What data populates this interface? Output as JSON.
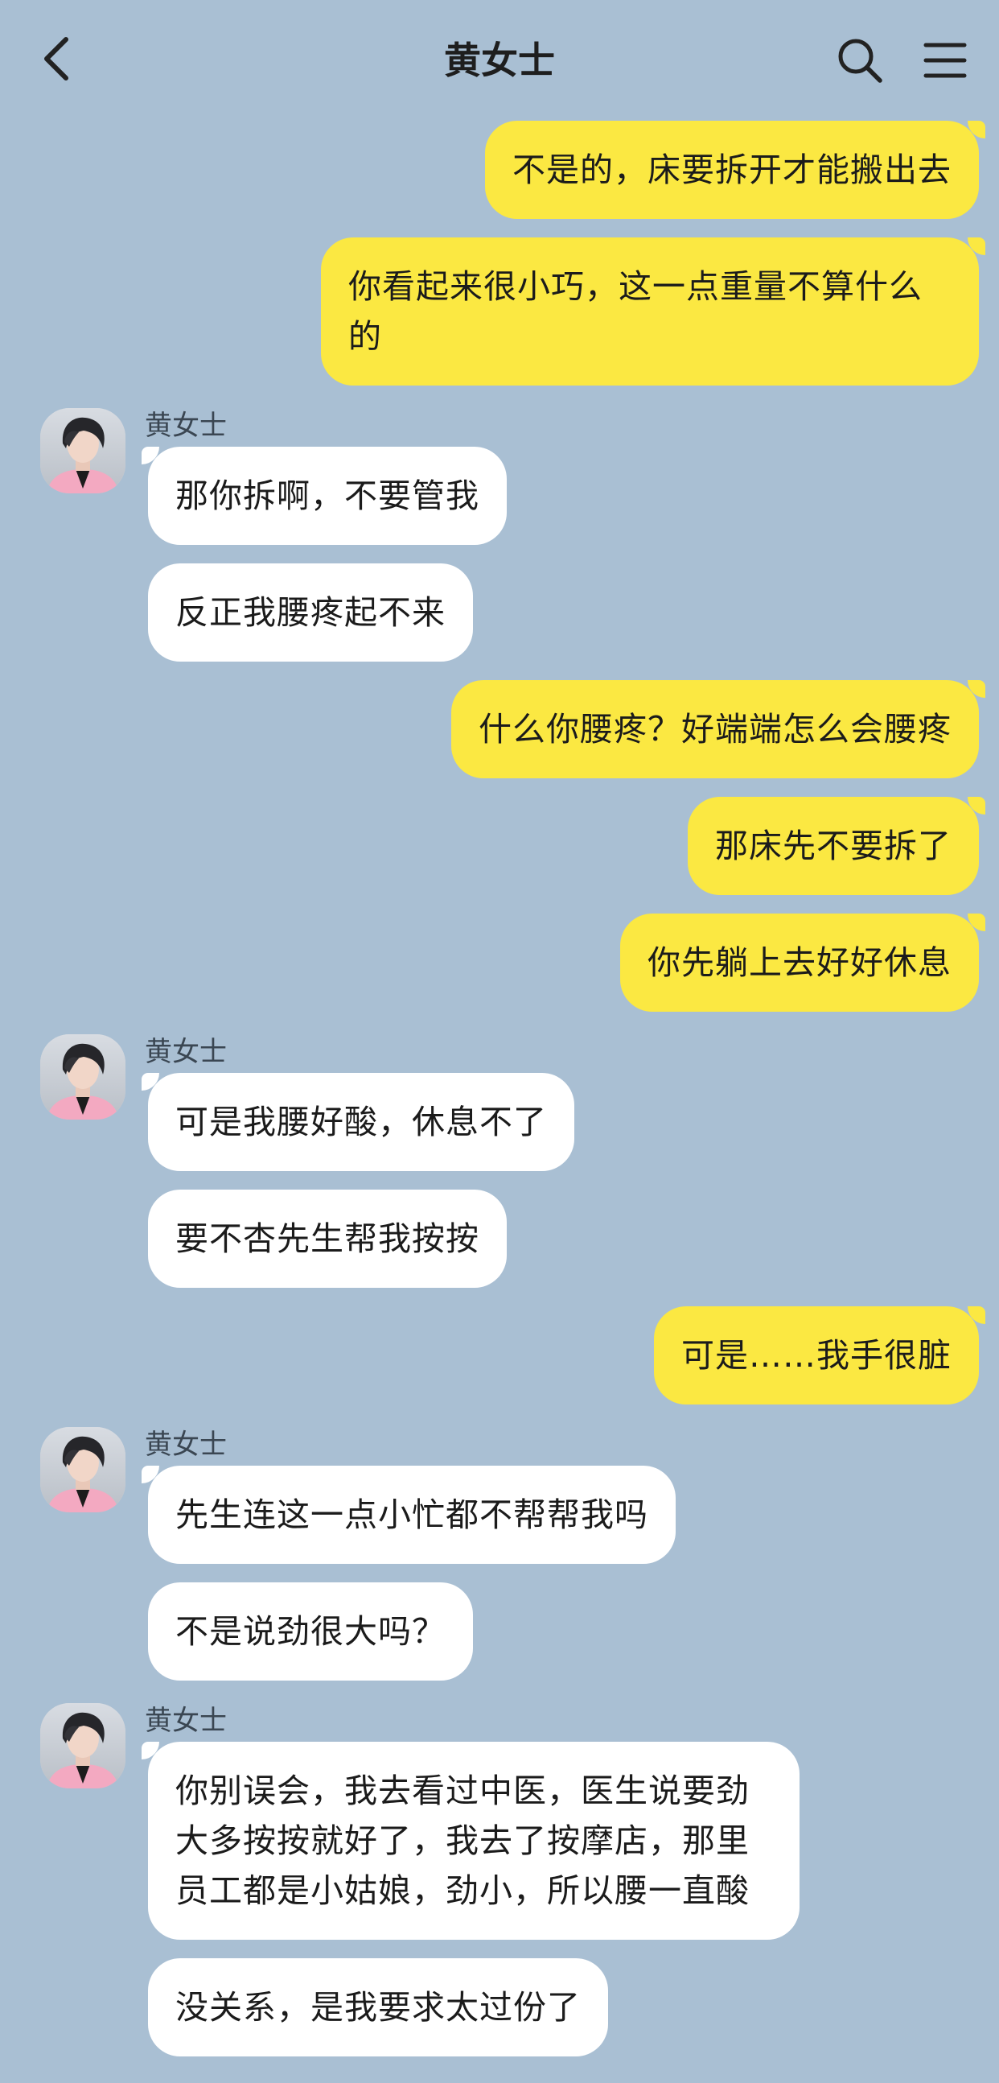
{
  "header": {
    "title": "黄女士"
  },
  "contact": {
    "name": "黄女士"
  },
  "messages": [
    {
      "dir": "out",
      "text": "不是的，床要拆开才能搬出去"
    },
    {
      "dir": "out",
      "text": "你看起来很小巧，这一点重量不算什么的"
    },
    {
      "dir": "in",
      "sender": "黄女士",
      "texts": [
        "那你拆啊，不要管我",
        "反正我腰疼起不来"
      ]
    },
    {
      "dir": "out",
      "text": "什么你腰疼？好端端怎么会腰疼"
    },
    {
      "dir": "out",
      "text": "那床先不要拆了"
    },
    {
      "dir": "out",
      "text": "你先躺上去好好休息"
    },
    {
      "dir": "in",
      "sender": "黄女士",
      "texts": [
        "可是我腰好酸，休息不了",
        "要不杏先生帮我按按"
      ]
    },
    {
      "dir": "out",
      "text": "可是……我手很脏"
    },
    {
      "dir": "in",
      "sender": "黄女士",
      "texts": [
        "先生连这一点小忙都不帮帮我吗",
        "不是说劲很大吗？"
      ]
    },
    {
      "dir": "in",
      "sender": "黄女士",
      "texts": [
        "你别误会，我去看过中医，医生说要劲大多按按就好了，我去了按摩店，那里员工都是小姑娘，劲小，所以腰一直酸",
        "没关系，是我要求太过份了"
      ]
    }
  ],
  "colors": {
    "background": "#a9bfd3",
    "outgoing_bubble": "#fbe842",
    "incoming_bubble": "#ffffff"
  },
  "icons": {
    "back": "chevron-left-icon",
    "search": "search-icon",
    "menu": "hamburger-menu-icon"
  }
}
